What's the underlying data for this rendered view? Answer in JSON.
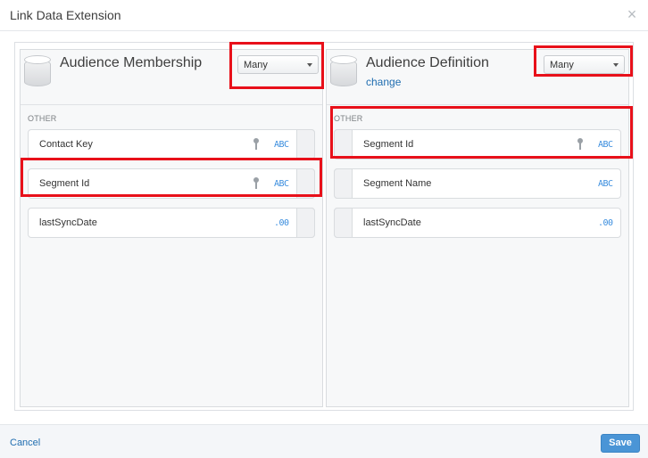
{
  "dialog": {
    "title": "Link Data Extension",
    "close_label": "×"
  },
  "left_panel": {
    "title": "Audience Membership",
    "cardinality": "Many",
    "section": "OTHER",
    "fields": [
      {
        "name": "Contact Key",
        "is_key": true,
        "type_label": "ABC"
      },
      {
        "name": "Segment Id",
        "is_key": true,
        "type_label": "ABC"
      },
      {
        "name": "lastSyncDate",
        "is_key": false,
        "type_label": ".00"
      }
    ]
  },
  "right_panel": {
    "title": "Audience Definition",
    "change_link": "change",
    "cardinality": "Many",
    "section": "OTHER",
    "fields": [
      {
        "name": "Segment Id",
        "is_key": true,
        "type_label": "ABC"
      },
      {
        "name": "Segment Name",
        "is_key": false,
        "type_label": "ABC"
      },
      {
        "name": "lastSyncDate",
        "is_key": false,
        "type_label": ".00"
      }
    ]
  },
  "footer": {
    "cancel_label": "Cancel",
    "save_label": "Save"
  },
  "colors": {
    "highlight": "#e8101a",
    "link": "#1f6db0",
    "type_badge": "#3a8dde",
    "save_button": "#4a95d6"
  }
}
